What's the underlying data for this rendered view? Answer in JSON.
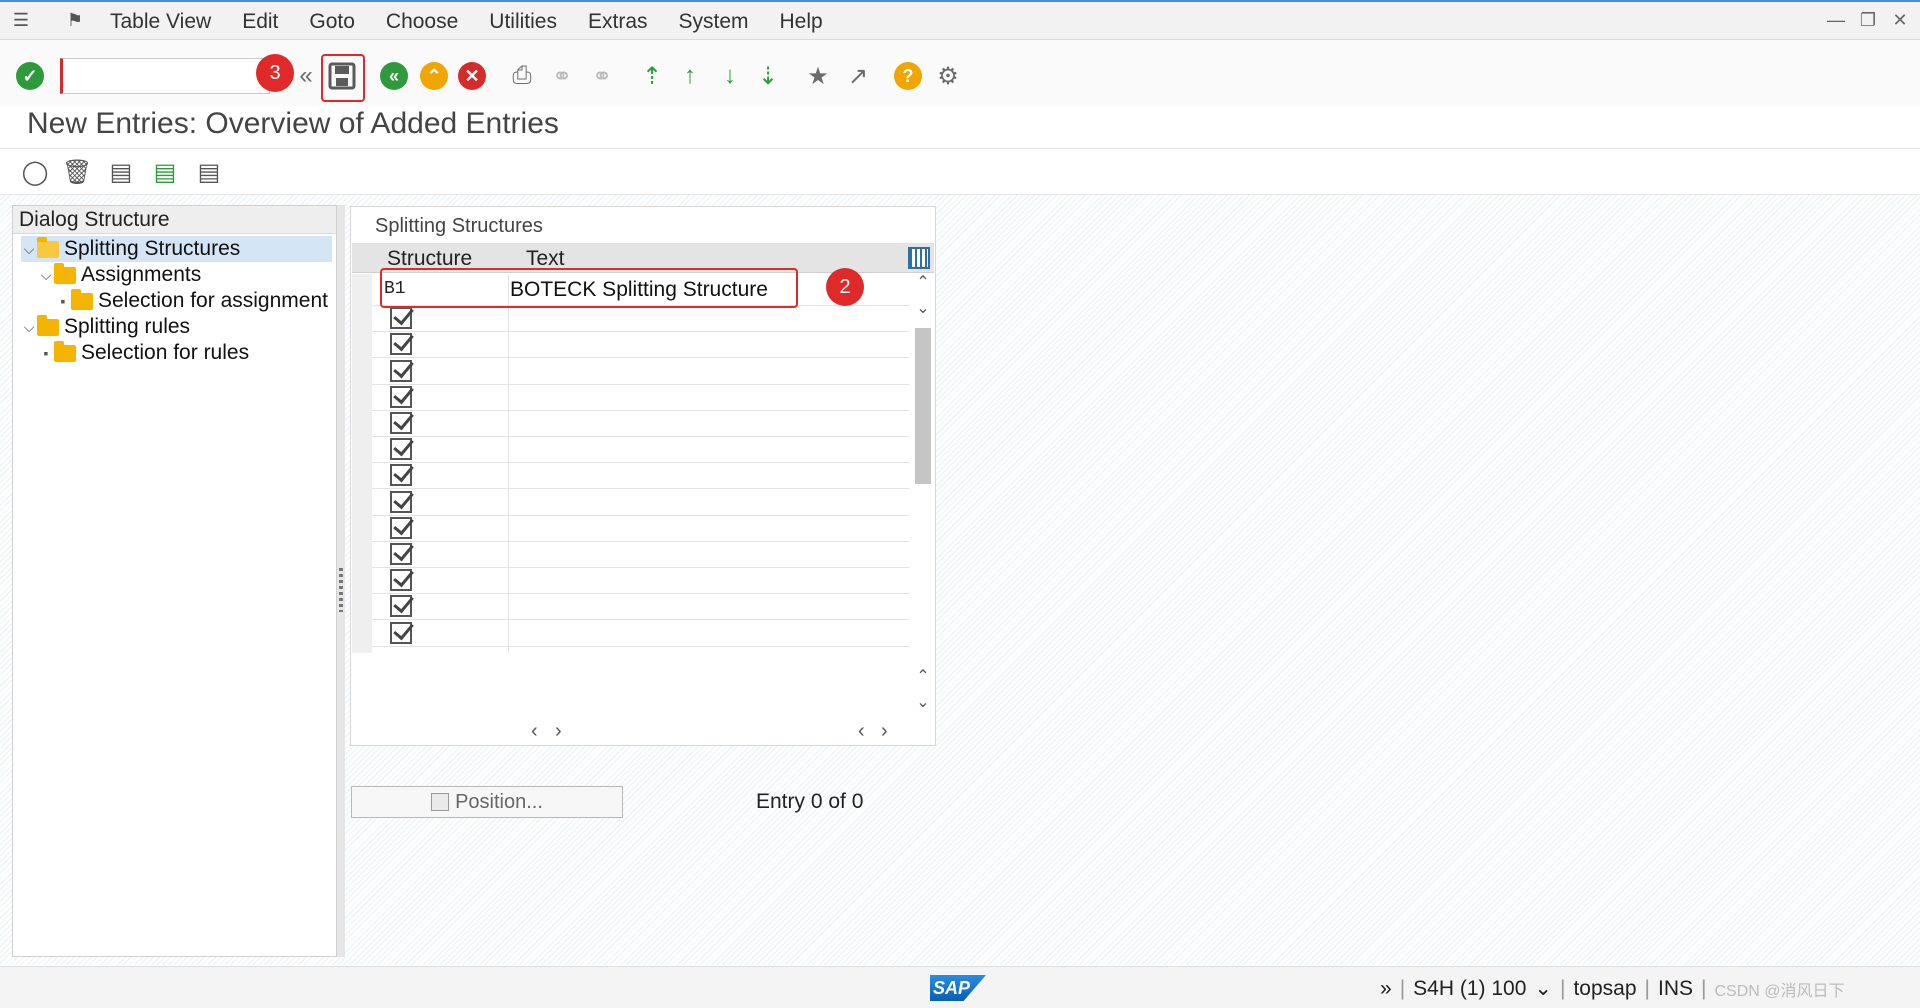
{
  "menubar": {
    "items": [
      {
        "label": "Table View",
        "ul": "T"
      },
      {
        "label": "Edit",
        "ul": "E"
      },
      {
        "label": "Goto",
        "ul": "G"
      },
      {
        "label": "Choose",
        "ul": "C"
      },
      {
        "label": "Utilities",
        "ul": "U"
      },
      {
        "label": "Extras",
        "ul": "x"
      },
      {
        "label": "System",
        "ul": "S"
      },
      {
        "label": "Help",
        "ul": "H"
      }
    ]
  },
  "toolbar": {
    "command_value": "",
    "badge_save": "3",
    "badge_row": "2"
  },
  "page": {
    "title": "New Entries: Overview of Added Entries"
  },
  "dialog_structure": {
    "header": "Dialog Structure",
    "items": [
      {
        "label": "Splitting Structures",
        "level": 0,
        "expanded": true,
        "selected": true
      },
      {
        "label": "Assignments",
        "level": 1,
        "expanded": true,
        "selected": false
      },
      {
        "label": "Selection for assignment",
        "level": 2,
        "expanded": false,
        "selected": false
      },
      {
        "label": "Splitting rules",
        "level": 0,
        "expanded": true,
        "selected": false
      },
      {
        "label": "Selection for rules",
        "level": 1,
        "expanded": false,
        "selected": false
      }
    ]
  },
  "table": {
    "title": "Splitting Structures",
    "columns": [
      "Structure",
      "Text"
    ],
    "rows": [
      {
        "structure": "B1",
        "text": "BOTECK  Splitting Structure",
        "has_checkbox": false
      },
      {
        "structure": "",
        "text": "",
        "has_checkbox": true
      },
      {
        "structure": "",
        "text": "",
        "has_checkbox": true
      },
      {
        "structure": "",
        "text": "",
        "has_checkbox": true
      },
      {
        "structure": "",
        "text": "",
        "has_checkbox": true
      },
      {
        "structure": "",
        "text": "",
        "has_checkbox": true
      },
      {
        "structure": "",
        "text": "",
        "has_checkbox": true
      },
      {
        "structure": "",
        "text": "",
        "has_checkbox": true
      },
      {
        "structure": "",
        "text": "",
        "has_checkbox": true
      },
      {
        "structure": "",
        "text": "",
        "has_checkbox": true
      },
      {
        "structure": "",
        "text": "",
        "has_checkbox": true
      },
      {
        "structure": "",
        "text": "",
        "has_checkbox": true
      },
      {
        "structure": "",
        "text": "",
        "has_checkbox": true
      },
      {
        "structure": "",
        "text": "",
        "has_checkbox": true
      }
    ]
  },
  "footer": {
    "position_label": "Position...",
    "entry_info": "Entry 0 of 0"
  },
  "statusbar": {
    "sap_logo": "SAP",
    "system": "S4H (1) 100",
    "server": "topsap",
    "mode": "INS",
    "watermark": "CSDN @消风日下"
  },
  "colors": {
    "accent_red": "#e02a2a",
    "ok_green": "#2f9a3b",
    "selection_blue": "#d4e6f5",
    "folder_yellow": "#f5b400"
  }
}
